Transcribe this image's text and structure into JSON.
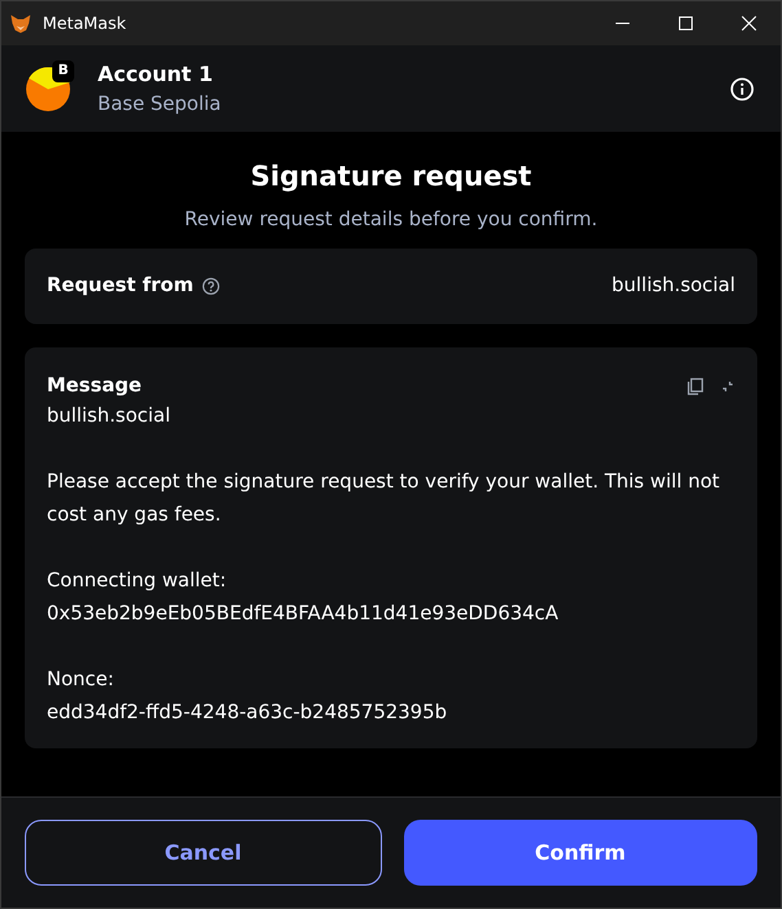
{
  "window": {
    "title": "MetaMask"
  },
  "account": {
    "name": "Account 1",
    "network": "Base Sepolia",
    "badge": "B"
  },
  "heading": "Signature request",
  "subheading": "Review request details before you confirm.",
  "request_from": {
    "label": "Request from",
    "value": "bullish.social"
  },
  "message": {
    "title": "Message",
    "paragraphs": [
      [
        "bullish.social"
      ],
      [
        "Please accept the signature request to verify your wallet. This will not cost any gas fees."
      ],
      [
        "Connecting wallet:",
        "0x53eb2b9eEb05BEdfE4BFAA4b11d41e93eDD634cA"
      ],
      [
        "Nonce:",
        "edd34df2-ffd5-4248-a63c-b2485752395b"
      ]
    ]
  },
  "buttons": [
    {
      "label": "Cancel",
      "kind": "secondary"
    },
    {
      "label": "Confirm",
      "kind": "primary"
    }
  ]
}
